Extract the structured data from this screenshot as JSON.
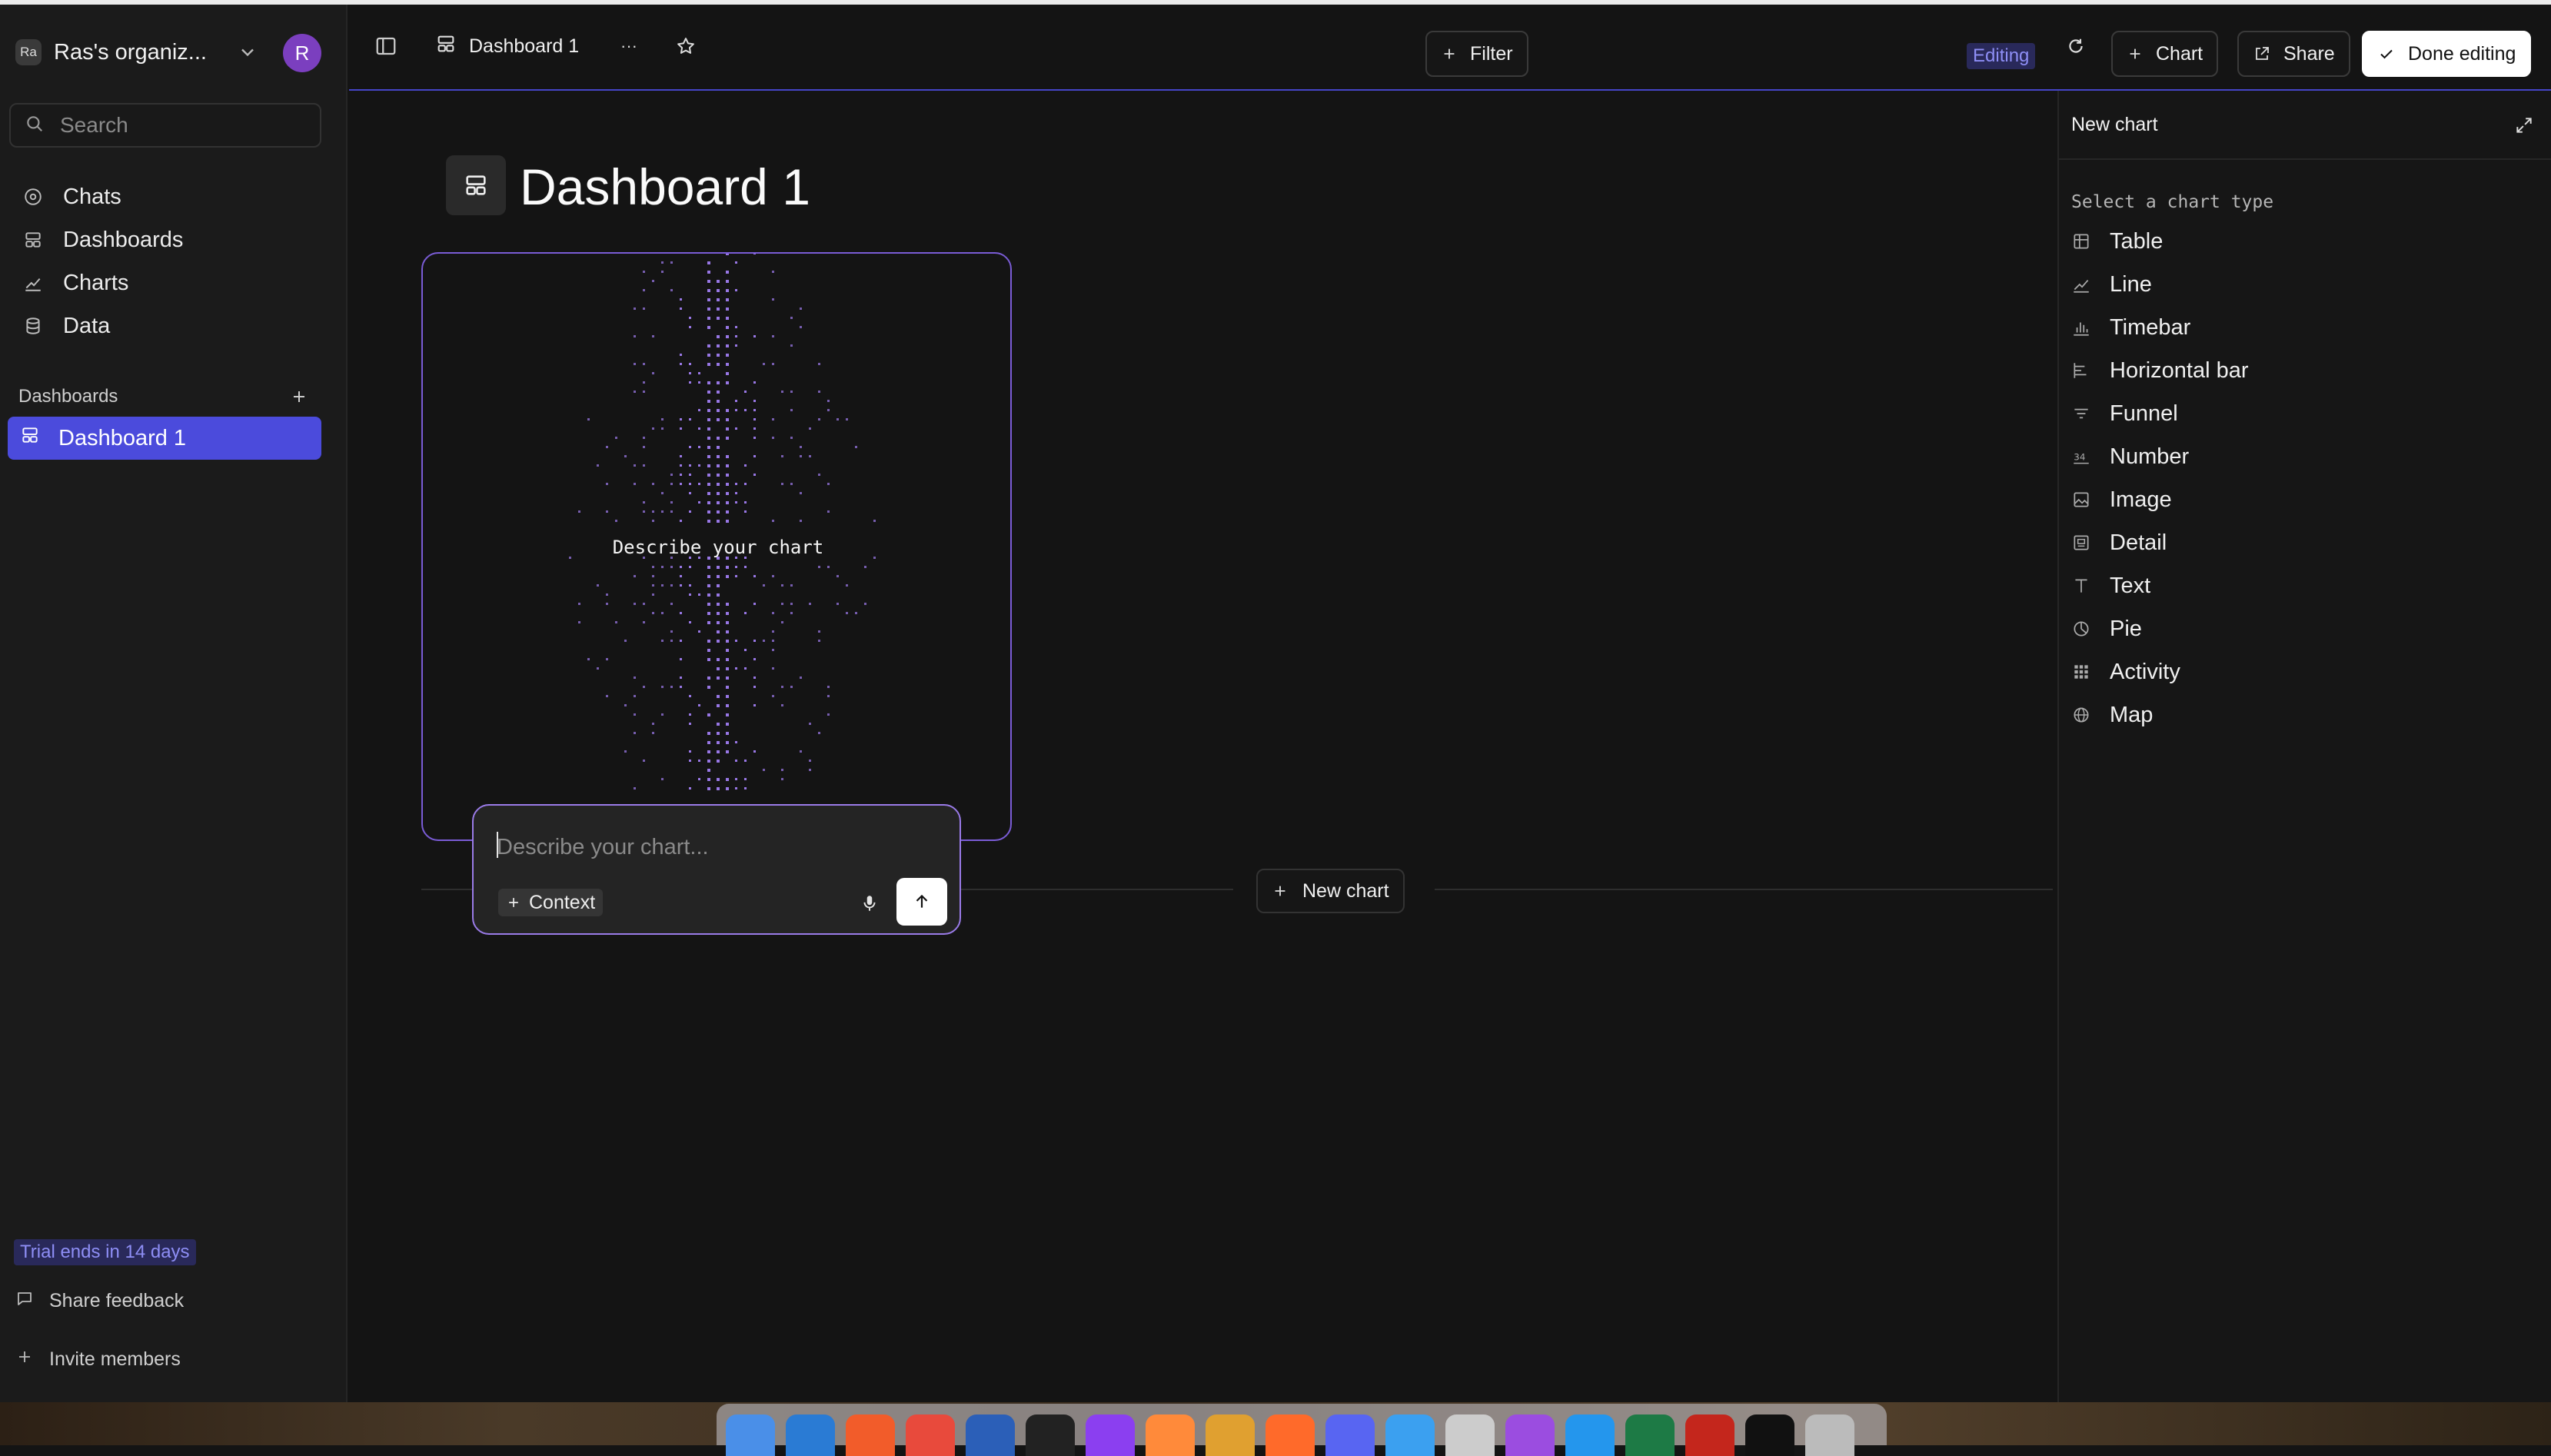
{
  "sidebar": {
    "org_badge": "Ra",
    "org_name": "Ras's organiz...",
    "avatar_initial": "R",
    "search_placeholder": "Search",
    "nav": [
      {
        "label": "Chats",
        "icon": "chat-icon"
      },
      {
        "label": "Dashboards",
        "icon": "dashboard-icon"
      },
      {
        "label": "Charts",
        "icon": "chart-icon"
      },
      {
        "label": "Data",
        "icon": "database-icon"
      }
    ],
    "dashboards_heading": "Dashboards",
    "dashboards": [
      {
        "label": "Dashboard 1",
        "active": true
      }
    ],
    "trial": "Trial ends in 14 days",
    "share_feedback": "Share feedback",
    "invite_members": "Invite members"
  },
  "topbar": {
    "tab_label": "Dashboard 1",
    "more": "···",
    "filter": "Filter",
    "editing_badge": "Editing",
    "chart": "Chart",
    "share": "Share",
    "done": "Done editing"
  },
  "main": {
    "title": "Dashboard 1",
    "card_caption": "Describe your chart",
    "prompt_placeholder": "Describe your chart...",
    "context_label": "Context",
    "new_chart": "New chart"
  },
  "panel": {
    "title": "New chart",
    "subtitle": "Select a chart type",
    "types": [
      {
        "label": "Table",
        "icon": "table-icon"
      },
      {
        "label": "Line",
        "icon": "line-chart-icon"
      },
      {
        "label": "Timebar",
        "icon": "timebar-icon"
      },
      {
        "label": "Horizontal bar",
        "icon": "horizontal-bar-icon"
      },
      {
        "label": "Funnel",
        "icon": "funnel-icon"
      },
      {
        "label": "Number",
        "icon": "number-icon"
      },
      {
        "label": "Image",
        "icon": "image-icon"
      },
      {
        "label": "Detail",
        "icon": "detail-icon"
      },
      {
        "label": "Text",
        "icon": "text-icon"
      },
      {
        "label": "Pie",
        "icon": "pie-icon"
      },
      {
        "label": "Activity",
        "icon": "activity-grid-icon"
      },
      {
        "label": "Map",
        "icon": "globe-icon"
      }
    ]
  },
  "colors": {
    "accent": "#4b4bdc",
    "card_border": "#7a5cd6",
    "badge_bg": "#29295a",
    "badge_text": "#8e8ef5",
    "dots": "#9f7cf0"
  },
  "dock": {
    "apps": [
      "finder",
      "vscode",
      "brave",
      "chrome",
      "word",
      "cursor",
      "datagrip",
      "sublime",
      "slack",
      "firefox",
      "discord",
      "xcode",
      "disk-utility",
      "podcasts",
      "docker",
      "excel",
      "acrobat",
      "terminal",
      "trash"
    ]
  }
}
